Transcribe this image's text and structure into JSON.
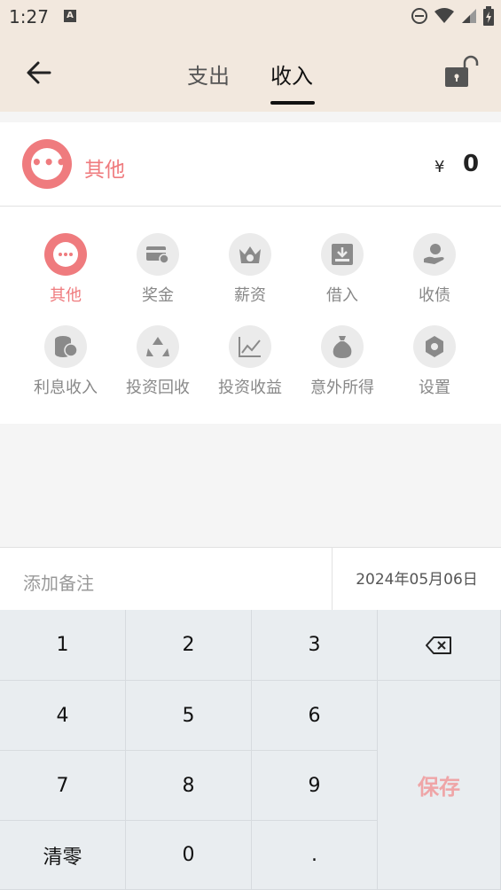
{
  "status_bar": {
    "time": "1:27",
    "notification_icon": "a-icon",
    "icons": [
      "dnd-icon",
      "wifi-icon",
      "signal-icon",
      "battery-icon"
    ]
  },
  "header": {
    "tabs": [
      {
        "label": "支出",
        "active": false
      },
      {
        "label": "收入",
        "active": true
      }
    ],
    "back_icon": "arrow-left-icon",
    "lock_icon": "unlock-icon"
  },
  "selected": {
    "icon": "more-dots-icon",
    "label": "其他",
    "currency": "¥",
    "amount": "0"
  },
  "categories": [
    {
      "label": "其他",
      "icon": "more-dots-icon",
      "active": true
    },
    {
      "label": "奖金",
      "icon": "bonus-card-icon",
      "active": false
    },
    {
      "label": "薪资",
      "icon": "crown-salary-icon",
      "active": false
    },
    {
      "label": "借入",
      "icon": "inbox-download-icon",
      "active": false
    },
    {
      "label": "收债",
      "icon": "hand-coin-icon",
      "active": false
    },
    {
      "label": "利息收入",
      "icon": "coins-icon",
      "active": false
    },
    {
      "label": "投资回收",
      "icon": "recycle-icon",
      "active": false
    },
    {
      "label": "投资收益",
      "icon": "line-chart-icon",
      "active": false
    },
    {
      "label": "意外所得",
      "icon": "money-bag-icon",
      "active": false
    },
    {
      "label": "设置",
      "icon": "gear-icon",
      "active": false
    }
  ],
  "note": {
    "placeholder": "添加备注"
  },
  "date": "2024年05月06日",
  "keypad": {
    "k1": "1",
    "k2": "2",
    "k3": "3",
    "k4": "4",
    "k5": "5",
    "k6": "6",
    "k7": "7",
    "k8": "8",
    "k9": "9",
    "clear": "清零",
    "k0": "0",
    "dot": ".",
    "backspace_icon": "backspace-icon",
    "save": "保存"
  },
  "colors": {
    "accent": "#ef7b7e",
    "header_bg": "#f2e8de",
    "keypad_bg": "#e9edf0"
  }
}
